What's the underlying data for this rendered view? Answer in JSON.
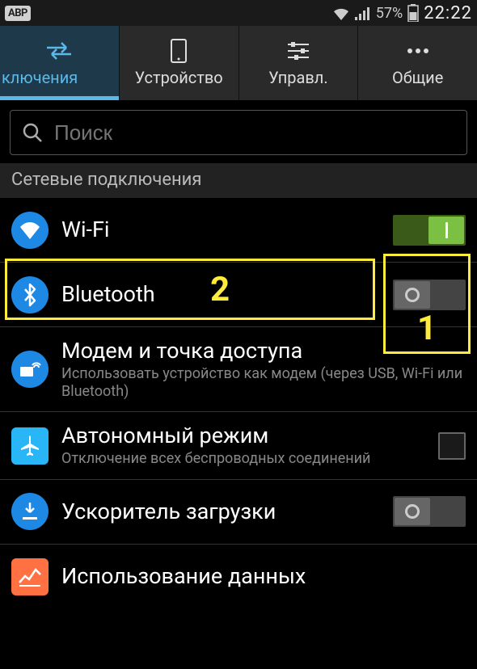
{
  "status": {
    "abp": "ABP",
    "battery_pct": "57%",
    "time": "22:22"
  },
  "tabs": [
    {
      "label": "ключения",
      "active": true
    },
    {
      "label": "Устройство",
      "active": false
    },
    {
      "label": "Управл.",
      "active": false
    },
    {
      "label": "Общие",
      "active": false
    }
  ],
  "search": {
    "placeholder": "Поиск"
  },
  "section_header": "Сетевые подключения",
  "rows": {
    "wifi": {
      "title": "Wi-Fi"
    },
    "bluetooth": {
      "title": "Bluetooth"
    },
    "tether": {
      "title": "Модем и точка доступа",
      "sub": "Использовать устройство как модем (через USB, Wi-Fi или Bluetooth)"
    },
    "airplane": {
      "title": "Автономный режим",
      "sub": "Отключение всех беспроводных соединений"
    },
    "boost": {
      "title": "Ускоритель загрузки"
    },
    "data": {
      "title": "Использование данных"
    }
  },
  "annotations": {
    "label1": "1",
    "label2": "2"
  }
}
